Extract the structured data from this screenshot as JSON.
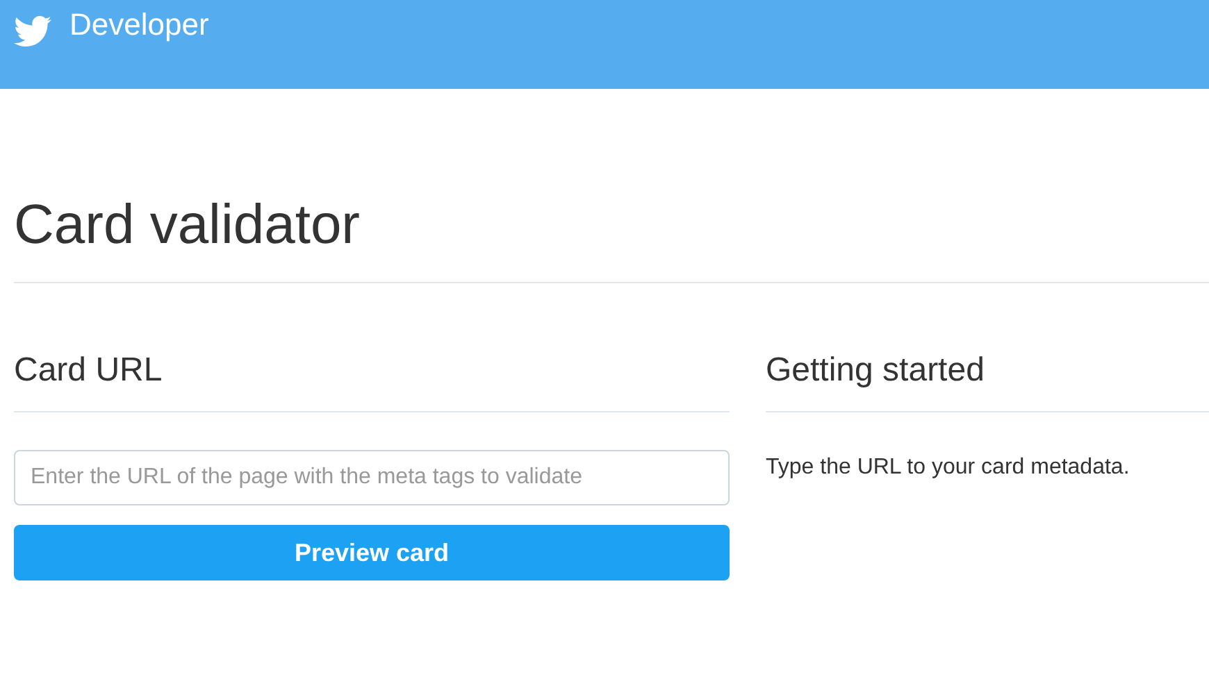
{
  "header": {
    "brand": "Developer"
  },
  "page_title": "Card validator",
  "card_url": {
    "heading": "Card URL",
    "input": {
      "placeholder": "Enter the URL of the page with the meta tags to validate"
    },
    "button": "Preview card"
  },
  "getting_started": {
    "heading": "Getting started",
    "text": "Type the URL to your card metadata."
  }
}
